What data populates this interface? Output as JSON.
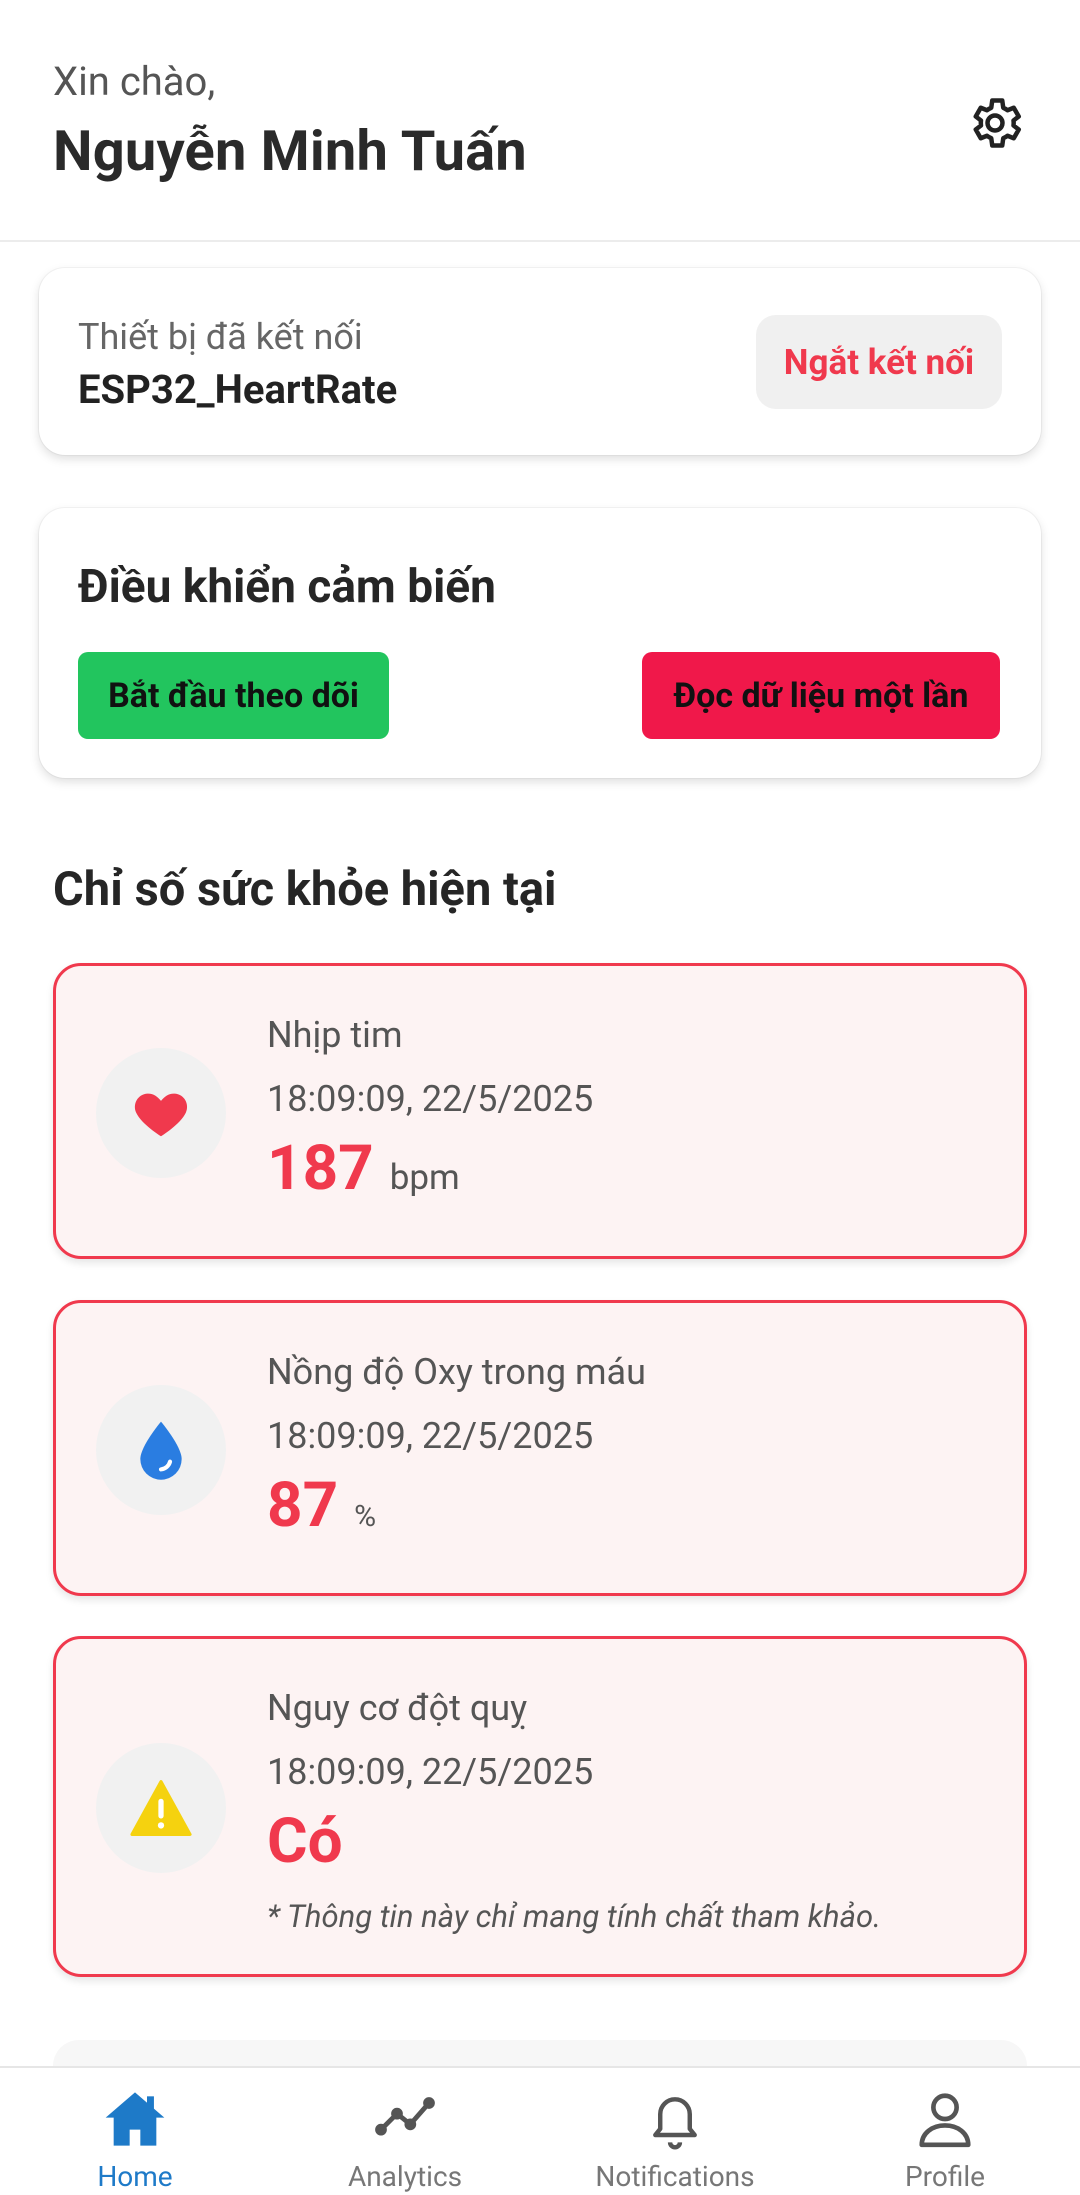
{
  "header": {
    "greeting": "Xin chào,",
    "user_name": "Nguyễn Minh Tuấn"
  },
  "device": {
    "label": "Thiết bị đã kết nối",
    "name": "ESP32_HeartRate",
    "disconnect_label": "Ngắt kết nối"
  },
  "control": {
    "title": "Điều khiển cảm biến",
    "start_label": "Bắt đầu theo dõi",
    "read_once_label": "Đọc dữ liệu một lần"
  },
  "section_title": "Chỉ số sức khỏe hiện tại",
  "metrics": [
    {
      "label": "Nhịp tim",
      "time": "18:09:09, 22/5/2025",
      "value": "187",
      "unit": "bpm",
      "icon": "heart-icon"
    },
    {
      "label": "Nồng độ Oxy trong máu",
      "time": "18:09:09, 22/5/2025",
      "value": "87",
      "unit": "%",
      "icon": "water-drop-icon"
    },
    {
      "label": "Nguy cơ đột quỵ",
      "time": "18:09:09, 22/5/2025",
      "value": "Có",
      "note": "* Thông tin này chỉ mang tính chất tham khảo.",
      "icon": "warning-icon"
    }
  ],
  "nav": {
    "items": [
      {
        "label": "Home",
        "icon": "home-icon",
        "active": true
      },
      {
        "label": "Analytics",
        "icon": "analytics-icon",
        "active": false
      },
      {
        "label": "Notifications",
        "icon": "bell-icon",
        "active": false
      },
      {
        "label": "Profile",
        "icon": "person-icon",
        "active": false
      }
    ]
  },
  "colors": {
    "accent_red": "#f0394d",
    "start_green": "#22c55e",
    "read_red": "#f0184a",
    "nav_active": "#1e7ac8",
    "metric_bg": "#fdf3f3"
  }
}
